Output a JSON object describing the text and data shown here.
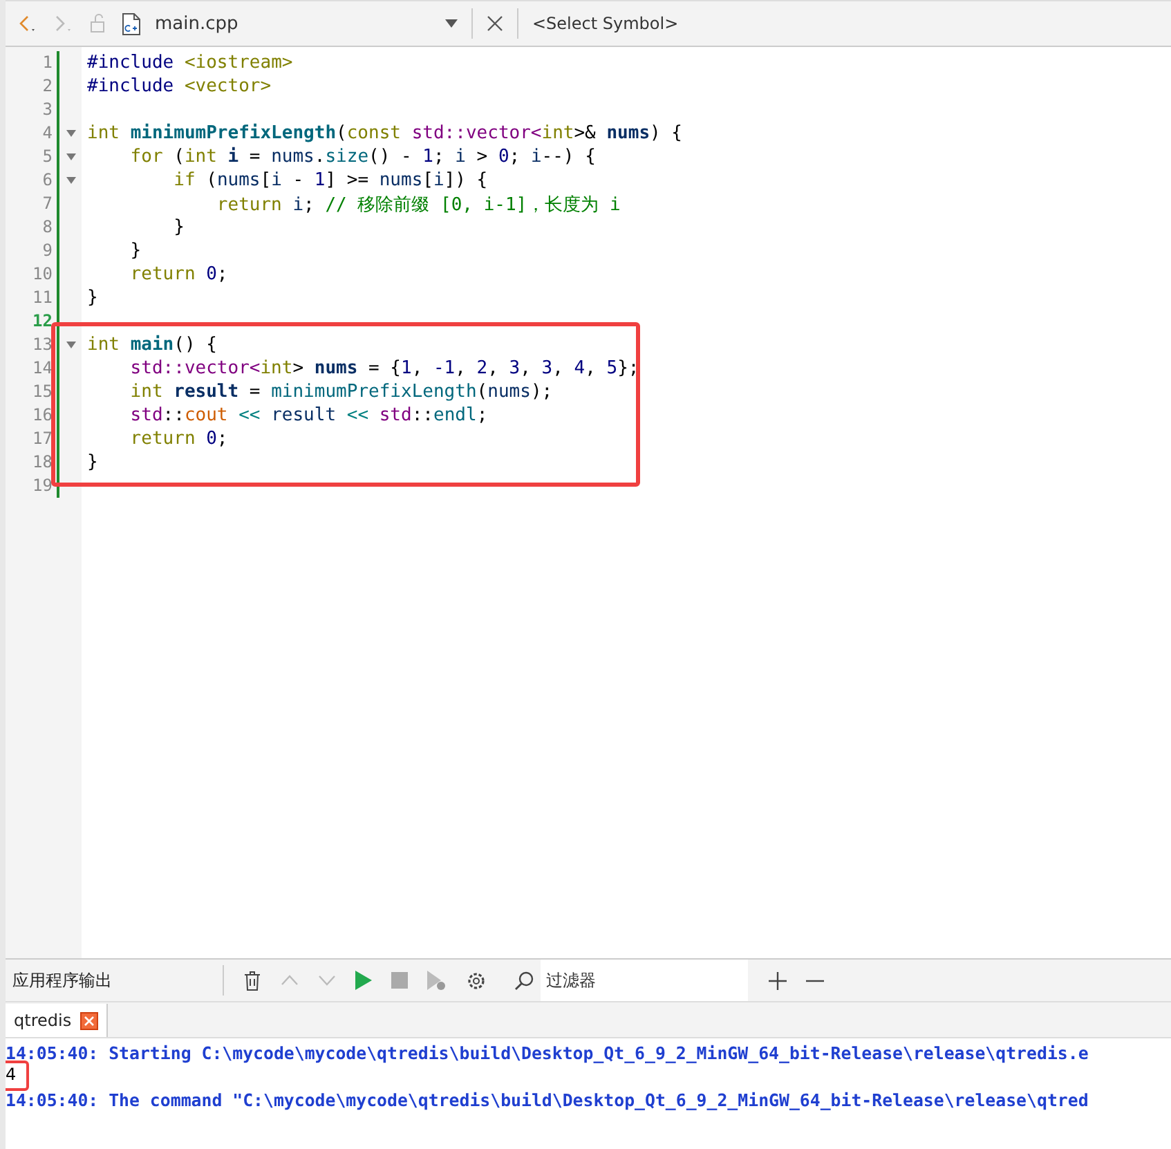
{
  "editor_toolbar": {
    "file": "main.cpp",
    "symbol": "<Select Symbol>"
  },
  "code_lines": [
    {
      "number": "1",
      "fold": false,
      "current": false,
      "tokens": [
        {
          "kind": "pp",
          "t": "#include "
        },
        {
          "kind": "str",
          "t": "<iostream>"
        }
      ]
    },
    {
      "number": "2",
      "fold": false,
      "current": false,
      "tokens": [
        {
          "kind": "pp",
          "t": "#include "
        },
        {
          "kind": "str",
          "t": "<vector>"
        }
      ]
    },
    {
      "number": "3",
      "fold": false,
      "current": false
    },
    {
      "number": "4",
      "fold": true,
      "current": false,
      "tokens": [
        {
          "kind": "kw",
          "t": "int "
        },
        {
          "kind": "fnb",
          "t": "minimumPrefixLength"
        },
        {
          "kind": "p",
          "t": "("
        },
        {
          "kind": "kw",
          "t": "const "
        },
        {
          "kind": "type",
          "t": "std::vector<"
        },
        {
          "kind": "kw",
          "t": "int"
        },
        {
          "kind": "p",
          "t": ">& "
        },
        {
          "kind": "decl",
          "t": "nums"
        },
        {
          "kind": "p",
          "t": ") {"
        }
      ]
    },
    {
      "number": "5",
      "fold": true,
      "current": false,
      "tokens": [
        {
          "kind": "kw",
          "t": "    for"
        },
        {
          "kind": "p",
          "t": " ("
        },
        {
          "kind": "kw",
          "t": "int "
        },
        {
          "kind": "decl",
          "t": "i"
        },
        {
          "kind": "p",
          "t": " = "
        },
        {
          "kind": "local",
          "t": "nums"
        },
        {
          "kind": "p",
          "t": "."
        },
        {
          "kind": "fn",
          "t": "size"
        },
        {
          "kind": "p",
          "t": "() - "
        },
        {
          "kind": "num",
          "t": "1"
        },
        {
          "kind": "p",
          "t": "; "
        },
        {
          "kind": "local",
          "t": "i"
        },
        {
          "kind": "p",
          "t": " > "
        },
        {
          "kind": "num",
          "t": "0"
        },
        {
          "kind": "p",
          "t": "; "
        },
        {
          "kind": "local",
          "t": "i"
        },
        {
          "kind": "p",
          "t": "--) {"
        }
      ]
    },
    {
      "number": "6",
      "fold": true,
      "current": false,
      "tokens": [
        {
          "kind": "kw",
          "t": "        if"
        },
        {
          "kind": "p",
          "t": " ("
        },
        {
          "kind": "local",
          "t": "nums"
        },
        {
          "kind": "p",
          "t": "["
        },
        {
          "kind": "local",
          "t": "i"
        },
        {
          "kind": "p",
          "t": " - "
        },
        {
          "kind": "num",
          "t": "1"
        },
        {
          "kind": "p",
          "t": "] >= "
        },
        {
          "kind": "local",
          "t": "nums"
        },
        {
          "kind": "p",
          "t": "["
        },
        {
          "kind": "local",
          "t": "i"
        },
        {
          "kind": "p",
          "t": "]) {"
        }
      ]
    },
    {
      "number": "7",
      "fold": false,
      "current": false,
      "tokens": [
        {
          "kind": "kw",
          "t": "            return "
        },
        {
          "kind": "local",
          "t": "i"
        },
        {
          "kind": "p",
          "t": "; "
        },
        {
          "kind": "comment",
          "t": "// 移除前缀 [0, i-1]，长度为 i"
        }
      ]
    },
    {
      "number": "8",
      "fold": false,
      "current": false,
      "tokens": [
        {
          "kind": "p",
          "t": "        }"
        }
      ]
    },
    {
      "number": "9",
      "fold": false,
      "current": false,
      "tokens": [
        {
          "kind": "p",
          "t": "    }"
        }
      ]
    },
    {
      "number": "10",
      "fold": false,
      "current": false,
      "tokens": [
        {
          "kind": "kw",
          "t": "    return "
        },
        {
          "kind": "num",
          "t": "0"
        },
        {
          "kind": "p",
          "t": ";"
        }
      ]
    },
    {
      "number": "11",
      "fold": false,
      "current": false,
      "tokens": [
        {
          "kind": "p",
          "t": "}"
        }
      ]
    },
    {
      "number": "12",
      "fold": false,
      "current": true
    },
    {
      "number": "13",
      "fold": true,
      "current": false,
      "tokens": [
        {
          "kind": "kw",
          "t": "int "
        },
        {
          "kind": "fnb",
          "t": "main"
        },
        {
          "kind": "p",
          "t": "() {"
        }
      ]
    },
    {
      "number": "14",
      "fold": false,
      "current": false,
      "tokens": [
        {
          "kind": "type",
          "t": "    std::vector<"
        },
        {
          "kind": "kw",
          "t": "int"
        },
        {
          "kind": "p",
          "t": "> "
        },
        {
          "kind": "decl",
          "t": "nums"
        },
        {
          "kind": "p",
          "t": " = {"
        },
        {
          "kind": "num",
          "t": "1"
        },
        {
          "kind": "p",
          "t": ", "
        },
        {
          "kind": "num",
          "t": "-1"
        },
        {
          "kind": "p",
          "t": ", "
        },
        {
          "kind": "num",
          "t": "2"
        },
        {
          "kind": "p",
          "t": ", "
        },
        {
          "kind": "num",
          "t": "3"
        },
        {
          "kind": "p",
          "t": ", "
        },
        {
          "kind": "num",
          "t": "3"
        },
        {
          "kind": "p",
          "t": ", "
        },
        {
          "kind": "num",
          "t": "4"
        },
        {
          "kind": "p",
          "t": ", "
        },
        {
          "kind": "num",
          "t": "5"
        },
        {
          "kind": "p",
          "t": "};"
        }
      ]
    },
    {
      "number": "15",
      "fold": false,
      "current": false,
      "tokens": [
        {
          "kind": "kw",
          "t": "    int "
        },
        {
          "kind": "decl",
          "t": "result"
        },
        {
          "kind": "p",
          "t": " = "
        },
        {
          "kind": "fn",
          "t": "minimumPrefixLength"
        },
        {
          "kind": "p",
          "t": "("
        },
        {
          "kind": "local",
          "t": "nums"
        },
        {
          "kind": "p",
          "t": ");"
        }
      ]
    },
    {
      "number": "16",
      "fold": false,
      "current": false,
      "tokens": [
        {
          "kind": "type",
          "t": "    std"
        },
        {
          "kind": "p",
          "t": "::"
        },
        {
          "kind": "stream",
          "t": "cout"
        },
        {
          "kind": "op",
          "t": " << "
        },
        {
          "kind": "local",
          "t": "result"
        },
        {
          "kind": "op",
          "t": " << "
        },
        {
          "kind": "type",
          "t": "std"
        },
        {
          "kind": "p",
          "t": "::"
        },
        {
          "kind": "fn",
          "t": "endl"
        },
        {
          "kind": "p",
          "t": ";"
        }
      ]
    },
    {
      "number": "17",
      "fold": false,
      "current": false,
      "tokens": [
        {
          "kind": "kw",
          "t": "    return "
        },
        {
          "kind": "num",
          "t": "0"
        },
        {
          "kind": "p",
          "t": ";"
        }
      ]
    },
    {
      "number": "18",
      "fold": false,
      "current": false,
      "tokens": [
        {
          "kind": "p",
          "t": "}"
        }
      ]
    },
    {
      "number": "19",
      "fold": false,
      "current": false
    }
  ],
  "output_pane": {
    "title": "应用程序输出",
    "filter_placeholder": "过滤器",
    "tabs": [
      {
        "label": "qtredis",
        "selected": true
      }
    ],
    "lines": [
      {
        "kind": "log",
        "text": "14:05:40: Starting C:\\mycode\\mycode\\qtredis\\build\\Desktop_Qt_6_9_2_MinGW_64_bit-Release\\release\\qtredis.e"
      },
      {
        "kind": "stdout",
        "text": "4"
      },
      {
        "kind": "log",
        "text": "14:05:40: The command \"C:\\mycode\\mycode\\qtredis\\build\\Desktop_Qt_6_9_2_MinGW_64_bit-Release\\release\\qtred"
      }
    ]
  }
}
